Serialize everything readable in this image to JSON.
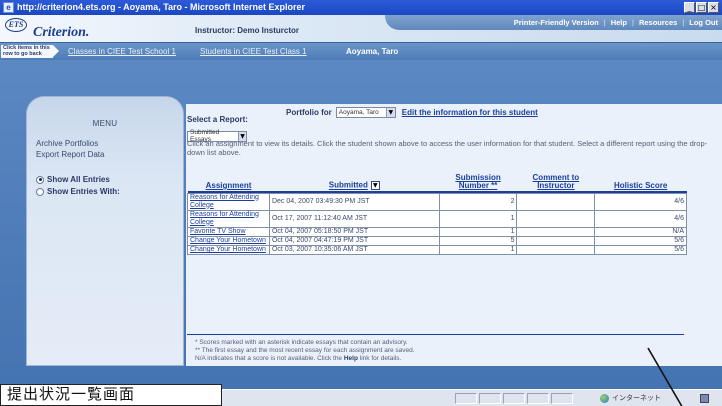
{
  "window": {
    "title": "http://criterion4.ets.org - Aoyama, Taro - Microsoft Internet Explorer",
    "controls": [
      "_",
      "□",
      "×"
    ]
  },
  "header": {
    "logo_text": "ETS",
    "brand": "Criterion.",
    "instructor": "Instructor: Demo Insturctor",
    "links": [
      "Printer-Friendly Version",
      "Help",
      "Resources",
      "Log Out"
    ]
  },
  "breadcrumb": {
    "hint": "Click items in this row to go back",
    "items": [
      "Classes in CIEE Test School 1",
      "Students in CIEE Test Class 1"
    ],
    "current": "Aoyama, Taro"
  },
  "sidebar": {
    "menu_title": "MENU",
    "links": [
      "Archive Portfolios",
      "Export Report Data"
    ],
    "filters": [
      {
        "label": "Show All Entries",
        "selected": true
      },
      {
        "label": "Show Entries With:",
        "selected": false
      }
    ]
  },
  "main": {
    "portfolio_label": "Portfolio for",
    "portfolio_value": "Aoyama, Taro",
    "edit_link": "Edit the information for this student",
    "select_report_label": "Select a Report:",
    "report_value": "Submitted Essays",
    "instructions": "Click an assignment to view its details. Click the student shown above to access the user information for that student. Select a different report using the drop-down list above.",
    "table": {
      "headers": {
        "assignment": "Assignment",
        "submitted": "Submitted",
        "submission_number": "Submission Number **",
        "comment": "Comment to Instructor",
        "score": "Holistic Score"
      },
      "rows": [
        {
          "assignment": "Reasons for Attending College",
          "submitted": "Dec 04, 2007 03:49:30 PM JST",
          "number": "2",
          "comment": "",
          "score": "4/6"
        },
        {
          "assignment": "Reasons for Attending College",
          "submitted": "Oct 17, 2007 11:12:40 AM JST",
          "number": "1",
          "comment": "",
          "score": "4/6"
        },
        {
          "assignment": "Favorite TV Show",
          "submitted": "Oct 04, 2007 05:18:50 PM JST",
          "number": "1",
          "comment": "",
          "score": "N/A"
        },
        {
          "assignment": "Change Your Hometown",
          "submitted": "Oct 04, 2007 04:47:19 PM JST",
          "number": "5",
          "comment": "",
          "score": "5/6"
        },
        {
          "assignment": "Change Your Hometown",
          "submitted": "Oct 03, 2007 10:35:06 AM JST",
          "number": "1",
          "comment": "",
          "score": "5/6"
        }
      ]
    },
    "notes": {
      "line1": "* Scores marked with an asterisk indicate essays that contain an advisory.",
      "line2": "** The first essay and the most recent essay for each assignment are saved.",
      "line3_pre": "N/A indicates that a score is not available. Click the",
      "line3_bold": "Help",
      "line3_post": "link for details."
    }
  },
  "statusbar": {
    "zone": "インターネット"
  },
  "caption": "提出状況一覧画面",
  "icons": {
    "ie_page": "ie-page-icon",
    "sort": "sort-toggle-icon",
    "dropdown": "chevron-down-icon",
    "zone": "globe-icon"
  }
}
